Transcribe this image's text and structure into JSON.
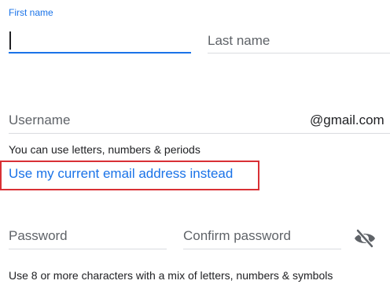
{
  "first_name": {
    "label": "First name",
    "value": ""
  },
  "last_name": {
    "placeholder": "Last name"
  },
  "username": {
    "placeholder": "Username",
    "suffix": "@gmail.com",
    "hint": "You can use letters, numbers & periods"
  },
  "use_current_email_link": "Use my current email address instead",
  "password": {
    "placeholder": "Password"
  },
  "confirm_password": {
    "placeholder": "Confirm password"
  },
  "password_visibility_icon": "eye-off-icon",
  "password_hint": "Use 8 or more characters with a mix of letters, numbers & symbols",
  "colors": {
    "accent": "#1a73e8",
    "highlight_border": "#d93035",
    "text": "#202124",
    "placeholder": "#5f6368",
    "line": "#dadce0"
  }
}
